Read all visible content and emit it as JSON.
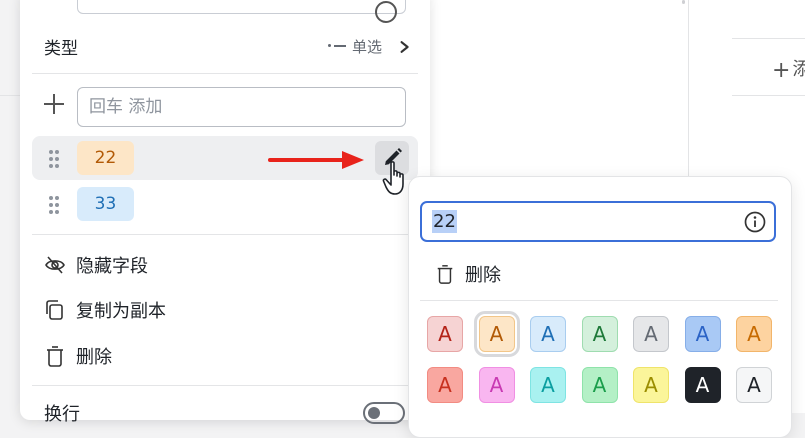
{
  "type_row": {
    "label": "类型",
    "value": "单选"
  },
  "add_option": {
    "placeholder": "回车 添加"
  },
  "options": [
    {
      "label": "22"
    },
    {
      "label": "33"
    }
  ],
  "menu": {
    "hide_field": "隐藏字段",
    "duplicate": "复制为副本",
    "delete": "删除",
    "wrap": "换行"
  },
  "background": {
    "add_label": "添"
  },
  "edit_popup": {
    "value": "22",
    "delete_label": "删除",
    "swatch_letter": "A",
    "swatches_row1": [
      {
        "bg": "#f6d3d3",
        "fg": "#b42318",
        "border": "#e7a6a6"
      },
      {
        "bg": "#fde6c7",
        "fg": "#b25a06",
        "border": "#f2c689"
      },
      {
        "bg": "#d8ebfb",
        "fg": "#1f6fb5",
        "border": "#a9cdef"
      },
      {
        "bg": "#d4f0dc",
        "fg": "#1f7a3a",
        "border": "#9fdcb0"
      },
      {
        "bg": "#e6e7e9",
        "fg": "#646a73",
        "border": "#c4c7cc"
      },
      {
        "bg": "#a9c9f5",
        "fg": "#2b63c6",
        "border": "#86aee8"
      },
      {
        "bg": "#fdd3a0",
        "fg": "#c76a00",
        "border": "#f2b56a"
      }
    ],
    "swatches_row2": [
      {
        "bg": "#f9a7a0",
        "fg": "#c8311f",
        "border": "#f28b82"
      },
      {
        "bg": "#f9b6f0",
        "fg": "#c93ab3",
        "border": "#f08fe3"
      },
      {
        "bg": "#a9f1f0",
        "fg": "#0b9ea0",
        "border": "#7fe4e3"
      },
      {
        "bg": "#b4f0c6",
        "fg": "#1b9e4b",
        "border": "#8fe3aa"
      },
      {
        "bg": "#fbf59a",
        "fg": "#9b8d00",
        "border": "#efe46a"
      },
      {
        "bg": "#1f2329",
        "fg": "#ffffff",
        "border": "#1f2329"
      },
      {
        "bg": "#f5f6f7",
        "fg": "#1f2329",
        "border": "#d0d3d6"
      }
    ]
  }
}
